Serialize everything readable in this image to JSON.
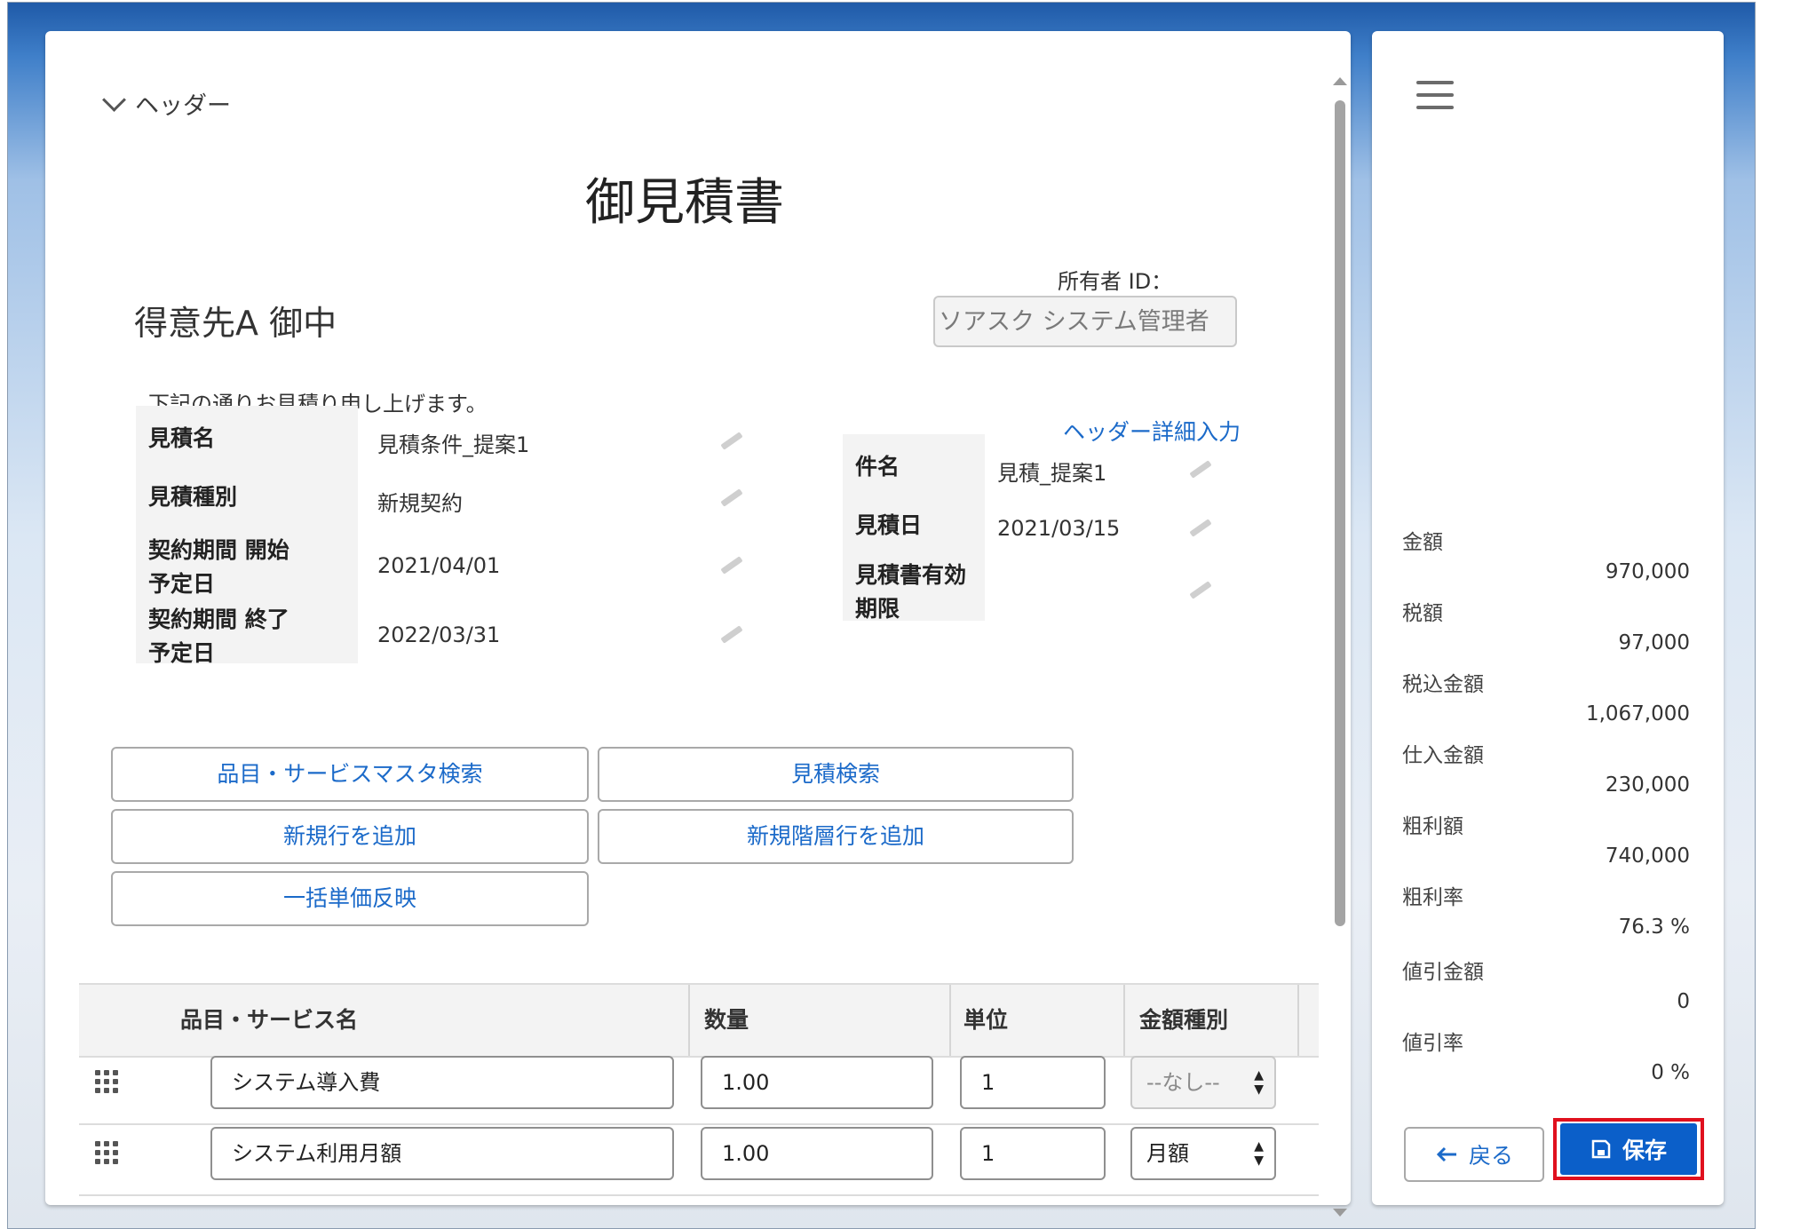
{
  "header": {
    "toggle_label": "ヘッダー",
    "title": "御見積書"
  },
  "owner": {
    "label": "所有者 ID：",
    "value": "ソアスク システム管理者"
  },
  "customer": "得意先A 御中",
  "intro": "下記の通りお見積り申し上げます。",
  "detail_link": "ヘッダー詳細入力",
  "left_fields": [
    {
      "label": "見積名",
      "value": "見積条件_提案1"
    },
    {
      "label": "見積種別",
      "value": "新規契約"
    },
    {
      "label": "契約期間 開始予定日",
      "value": "2021/04/01"
    },
    {
      "label": "契約期間 終了予定日",
      "value": "2022/03/31"
    }
  ],
  "right_fields": [
    {
      "label": "件名",
      "value": "見積_提案1"
    },
    {
      "label": "見積日",
      "value": "2021/03/15"
    },
    {
      "label": "見積書有効期限",
      "value": ""
    }
  ],
  "buttons": {
    "master_search": "品目・サービスマスタ検索",
    "quote_search": "見積検索",
    "add_row": "新規行を追加",
    "add_hier_row": "新規階層行を追加",
    "bulk_price": "一括単価反映"
  },
  "table": {
    "columns": [
      "品目・サービス名",
      "数量",
      "単位",
      "金額種別"
    ],
    "rows": [
      {
        "name": "システム導入費",
        "qty": "1.00",
        "unit": "1",
        "type": "--なし--",
        "type_disabled": true
      },
      {
        "name": "システム利用月額",
        "qty": "1.00",
        "unit": "1",
        "type": "月額",
        "type_disabled": false
      }
    ]
  },
  "summary": [
    {
      "label": "金額",
      "value": "970,000"
    },
    {
      "label": "税額",
      "value": "97,000"
    },
    {
      "label": "税込金額",
      "value": "1,067,000"
    },
    {
      "label": "仕入金額",
      "value": "230,000"
    },
    {
      "label": "粗利額",
      "value": "740,000"
    },
    {
      "label": "粗利率",
      "value": "76.3 %"
    },
    {
      "label": "値引金額",
      "value": "0"
    },
    {
      "label": "値引率",
      "value": "0 %"
    }
  ],
  "actions": {
    "back": "戻る",
    "save": "保存"
  },
  "icons": {
    "menu": "hamburger-icon",
    "back": "arrow-left-icon",
    "save": "save-icon",
    "edit": "pencil-icon",
    "drag": "drag-handle-icon"
  },
  "colors": {
    "accent": "#0b5fc9",
    "link": "#1b6ac9",
    "highlight": "#e0101e"
  }
}
